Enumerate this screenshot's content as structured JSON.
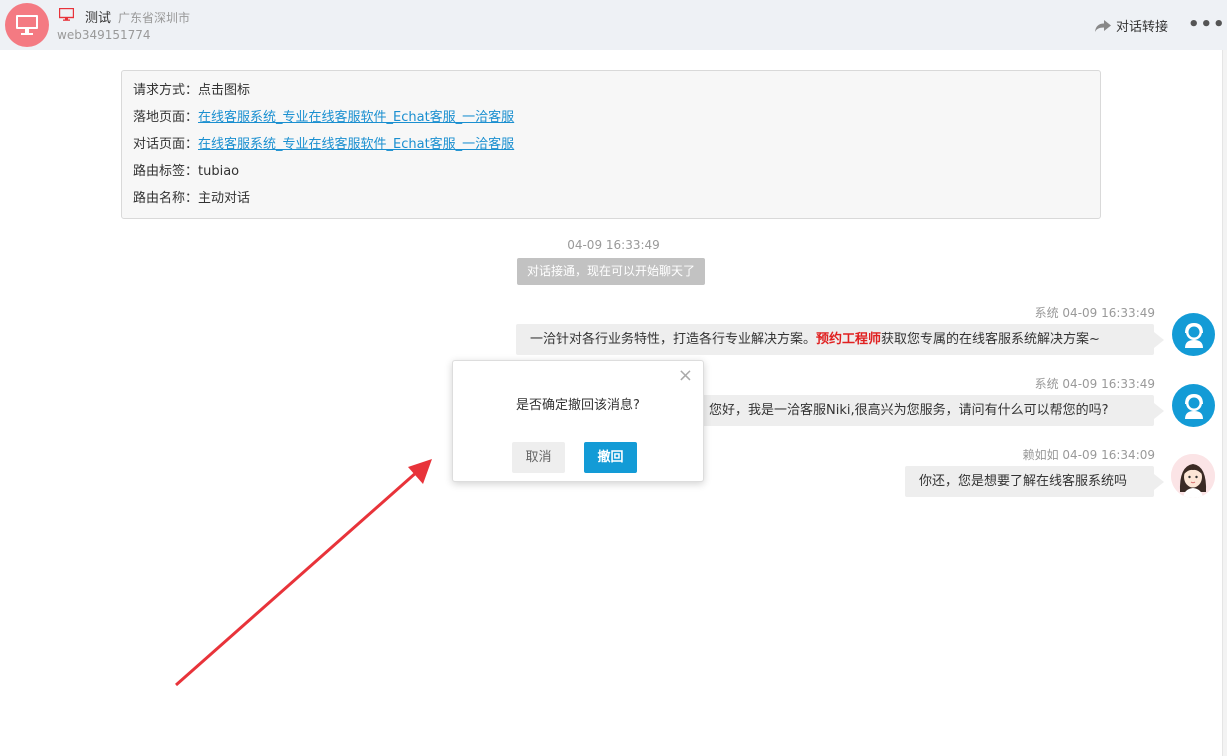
{
  "header": {
    "visitor_name": "测试",
    "visitor_location": "广东省深圳市",
    "visitor_id": "web349151774",
    "transfer_label": "对话转接",
    "more_label": "•••",
    "avatar_color": "#f47a82",
    "device_icon": "monitor-icon"
  },
  "info": {
    "rows": [
      {
        "label": "请求方式：",
        "value": "点击图标",
        "link": false
      },
      {
        "label": "落地页面：",
        "value": "在线客服系统_专业在线客服软件_Echat客服_一洽客服",
        "link": true
      },
      {
        "label": "对话页面：",
        "value": "在线客服系统_专业在线客服软件_Echat客服_一洽客服",
        "link": true
      },
      {
        "label": "路由标签：",
        "value": "tubiao",
        "link": false
      },
      {
        "label": "路由名称：",
        "value": "主动对话",
        "link": false
      }
    ]
  },
  "chat": {
    "center_time": "04-09 16:33:49",
    "notice": "对话接通，现在可以开始聊天了",
    "messages": [
      {
        "sender": "系统",
        "time": "04-09 16:33:49",
        "text_before": "一洽针对各行业务特性，打造各行专业解决方案。",
        "highlight": "预约工程师",
        "text_after": "获取您专属的在线客服系统解决方案~"
      },
      {
        "sender": "系统",
        "time": "04-09 16:33:49",
        "text": "您好，我是一洽客服Niki,很高兴为您服务，请问有什么可以帮您的吗?"
      },
      {
        "sender": "赖如如",
        "time": "04-09 16:34:09",
        "text": "你还，您是想要了解在线客服系统吗"
      }
    ]
  },
  "modal": {
    "message": "是否确定撤回该消息?",
    "close": "×",
    "cancel_label": "取消",
    "confirm_label": "撤回"
  },
  "colors": {
    "accent": "#139bd6",
    "link": "#1a8fd0",
    "highlight": "#e02020",
    "annotation_arrow": "#e8333a"
  }
}
